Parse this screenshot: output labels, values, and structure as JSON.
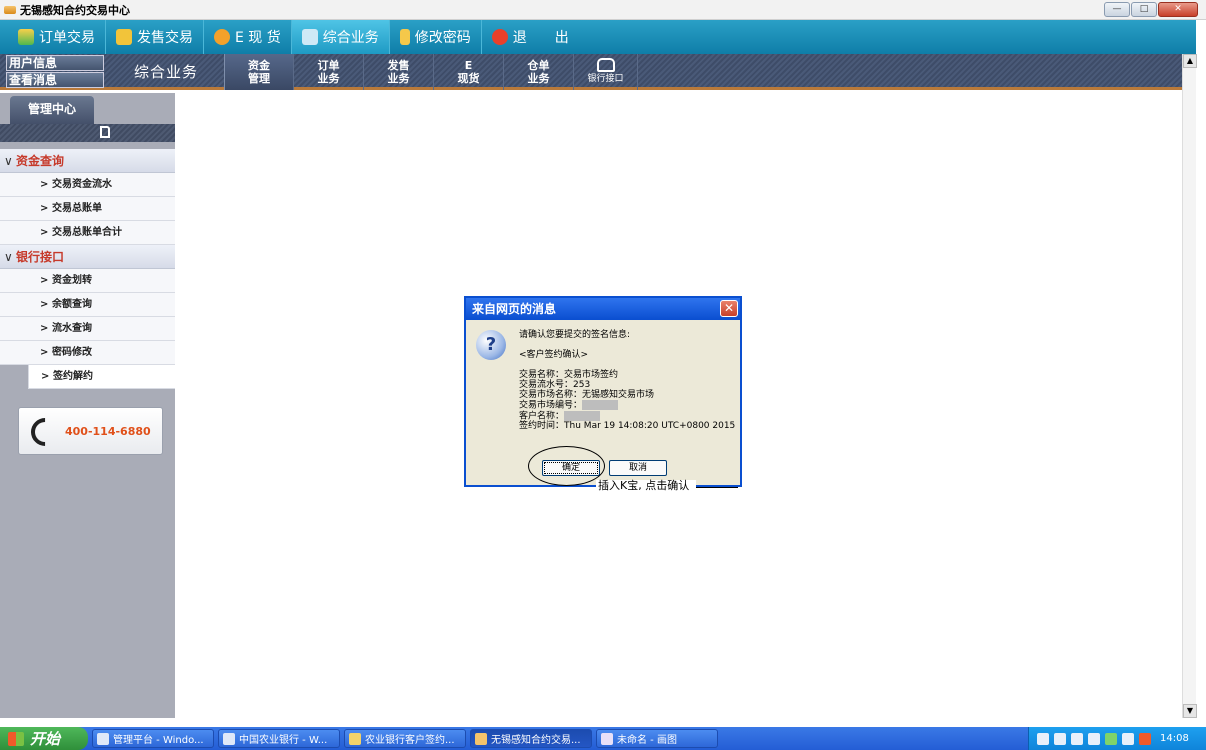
{
  "window": {
    "title": "无锡感知合约交易中心"
  },
  "topnav": {
    "items": [
      {
        "label": "订单交易",
        "icon": "chart-icon"
      },
      {
        "label": "发售交易",
        "icon": "yen-icon"
      },
      {
        "label": "E 现 货",
        "icon": "e-coin-icon"
      },
      {
        "label": "综合业务",
        "icon": "monitor-icon",
        "active": true
      },
      {
        "label": "修改密码",
        "icon": "key-icon"
      },
      {
        "label": "退　　出",
        "icon": "power-icon"
      }
    ]
  },
  "subnav": {
    "user_info": "用户信息",
    "view_messages": "查看消息",
    "section_title": "综合业务",
    "tabs": [
      {
        "line1": "资金",
        "line2": "管理",
        "active": true
      },
      {
        "line1": "订单",
        "line2": "业务"
      },
      {
        "line1": "发售",
        "line2": "业务"
      },
      {
        "line1": "E",
        "line2": "现货"
      },
      {
        "line1": "仓单",
        "line2": "业务"
      },
      {
        "line1": "",
        "line2": "银行接口",
        "icon": "bank-icon"
      }
    ]
  },
  "sidebar": {
    "tab_label": "管理中心",
    "sections": [
      {
        "label": "资金查询",
        "items": [
          "交易资金流水",
          "交易总账单",
          "交易总账单合计"
        ]
      },
      {
        "label": "银行接口",
        "items": [
          "资金划转",
          "余额查询",
          "流水查询",
          "密码修改",
          "签约解约"
        ]
      }
    ],
    "active_item": "签约解约",
    "phone": "400-114-6880"
  },
  "dialog": {
    "title": "来自网页的消息",
    "prompt": "请确认您要提交的签名信息:",
    "header": "<客户签约确认>",
    "fields": [
      {
        "label": "交易名称",
        "value": "交易市场签约"
      },
      {
        "label": "交易流水号",
        "value": "253"
      },
      {
        "label": "交易市场名称",
        "value": "无锡感知交易市场"
      },
      {
        "label": "交易市场编号",
        "value": ""
      },
      {
        "label": "客户名称",
        "value": ""
      },
      {
        "label": "签约时间",
        "value": "Thu Mar 19 14:08:20 UTC+0800 2015"
      }
    ],
    "ok_label": "确定",
    "cancel_label": "取消"
  },
  "annotation": {
    "text": "插入K宝, 点击确认"
  },
  "taskbar": {
    "start_label": "开始",
    "tasks": [
      {
        "label": "管理平台 - Windo...",
        "active": false
      },
      {
        "label": "中国农业银行 - W...",
        "active": false
      },
      {
        "label": "农业银行客户签约...",
        "active": false
      },
      {
        "label": "无锡感知合约交易...",
        "active": true
      },
      {
        "label": "未命名 - 画图",
        "active": false
      }
    ],
    "clock": "14:08"
  },
  "colors": {
    "topnav": "#1a8fb8",
    "subnav": "#44526e",
    "accent_red": "#c6392a",
    "phone_orange": "#e0501a",
    "dialog_title": "#0a4ed0"
  }
}
